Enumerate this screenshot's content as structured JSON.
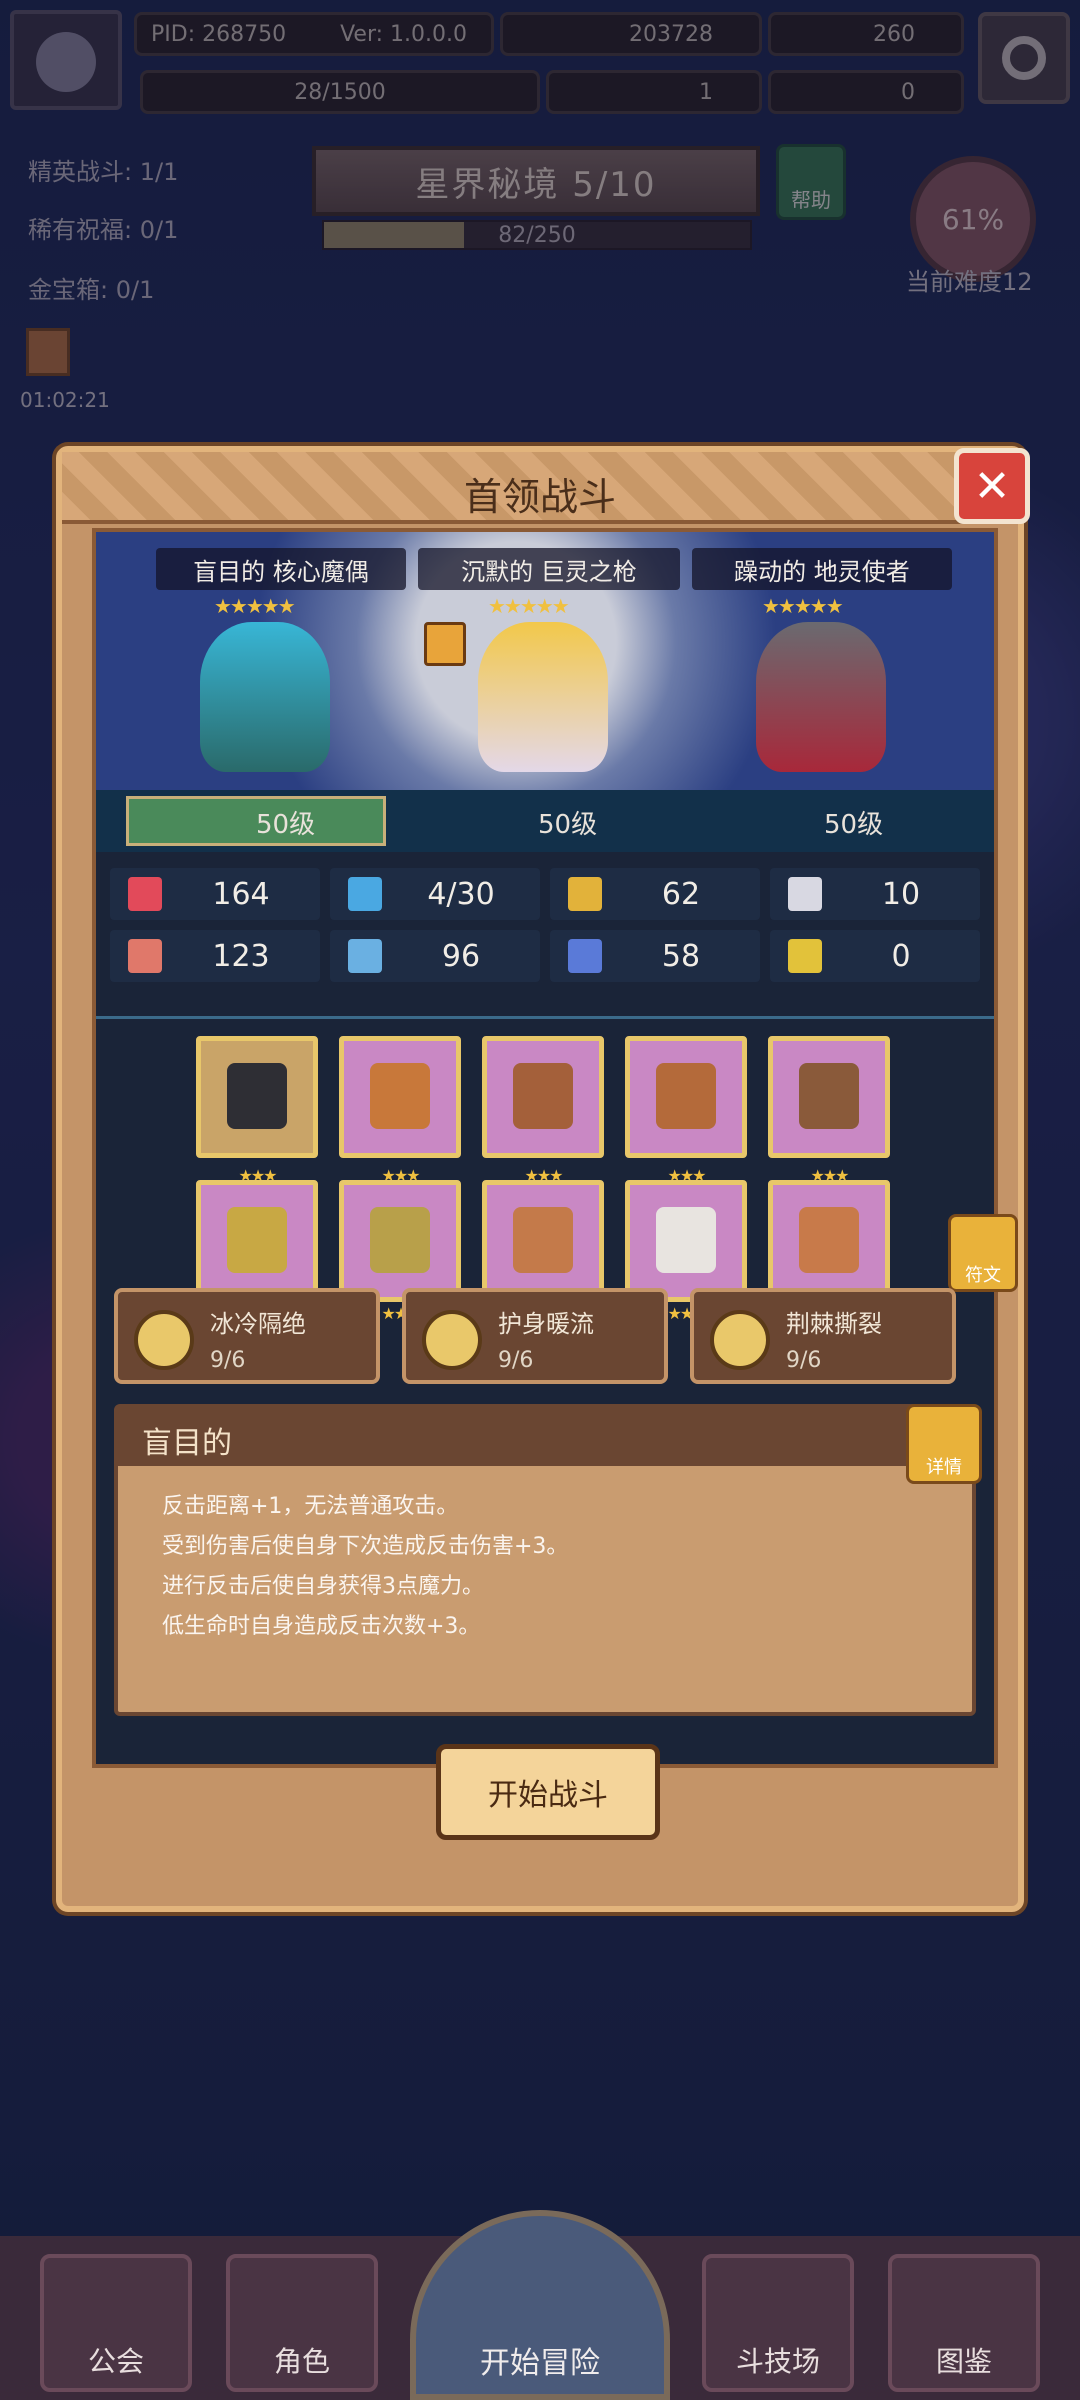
{
  "topbar": {
    "pid": "PID: 268750",
    "version": "Ver: 1.0.0.0",
    "gold": "203728",
    "gems": "260",
    "energy": "28/1500",
    "clover": "1",
    "item": "0"
  },
  "side": {
    "elite": "精英战斗: 1/1",
    "blessing": "稀有祝福: 0/1",
    "chest": "金宝箱: 0/1",
    "timer": "01:02:21"
  },
  "stage": {
    "title": "星界秘境 5/10",
    "progress_text": "82/250",
    "progress": 0.328,
    "help": "帮助",
    "difficulty_pct": "61%",
    "difficulty_label": "当前难度12"
  },
  "modal": {
    "title": "首领战斗",
    "bosses": [
      {
        "name": "盲目的 核心魔偶",
        "stars": "★★★★★",
        "level": "50级"
      },
      {
        "name": "沉默的 巨灵之枪",
        "stars": "★★★★★",
        "level": "50级"
      },
      {
        "name": "躁动的 地灵使者",
        "stars": "★★★★★",
        "level": "50级"
      }
    ],
    "stats": [
      "164",
      "4/30",
      "62",
      "10",
      "123",
      "96",
      "58",
      "0"
    ],
    "equip_stars": "★★★",
    "rune_label": "符文",
    "sets": [
      {
        "name": "冰冷隔绝",
        "count": "9/6"
      },
      {
        "name": "护身暖流",
        "count": "9/6"
      },
      {
        "name": "荆棘撕裂",
        "count": "9/6"
      }
    ],
    "desc_title": "盲目的",
    "detail_label": "详情",
    "desc_lines": [
      "反击距离+1，无法普通攻击。",
      "受到伤害后使自身下次造成反击伤害+3。",
      "进行反击后使自身获得3点魔力。",
      "低生命时自身造成反击次数+3。"
    ],
    "start_label": "开始战斗"
  },
  "nav": {
    "guild": "公会",
    "role": "角色",
    "adventure": "开始冒险",
    "arena": "斗技场",
    "codex": "图鉴"
  }
}
